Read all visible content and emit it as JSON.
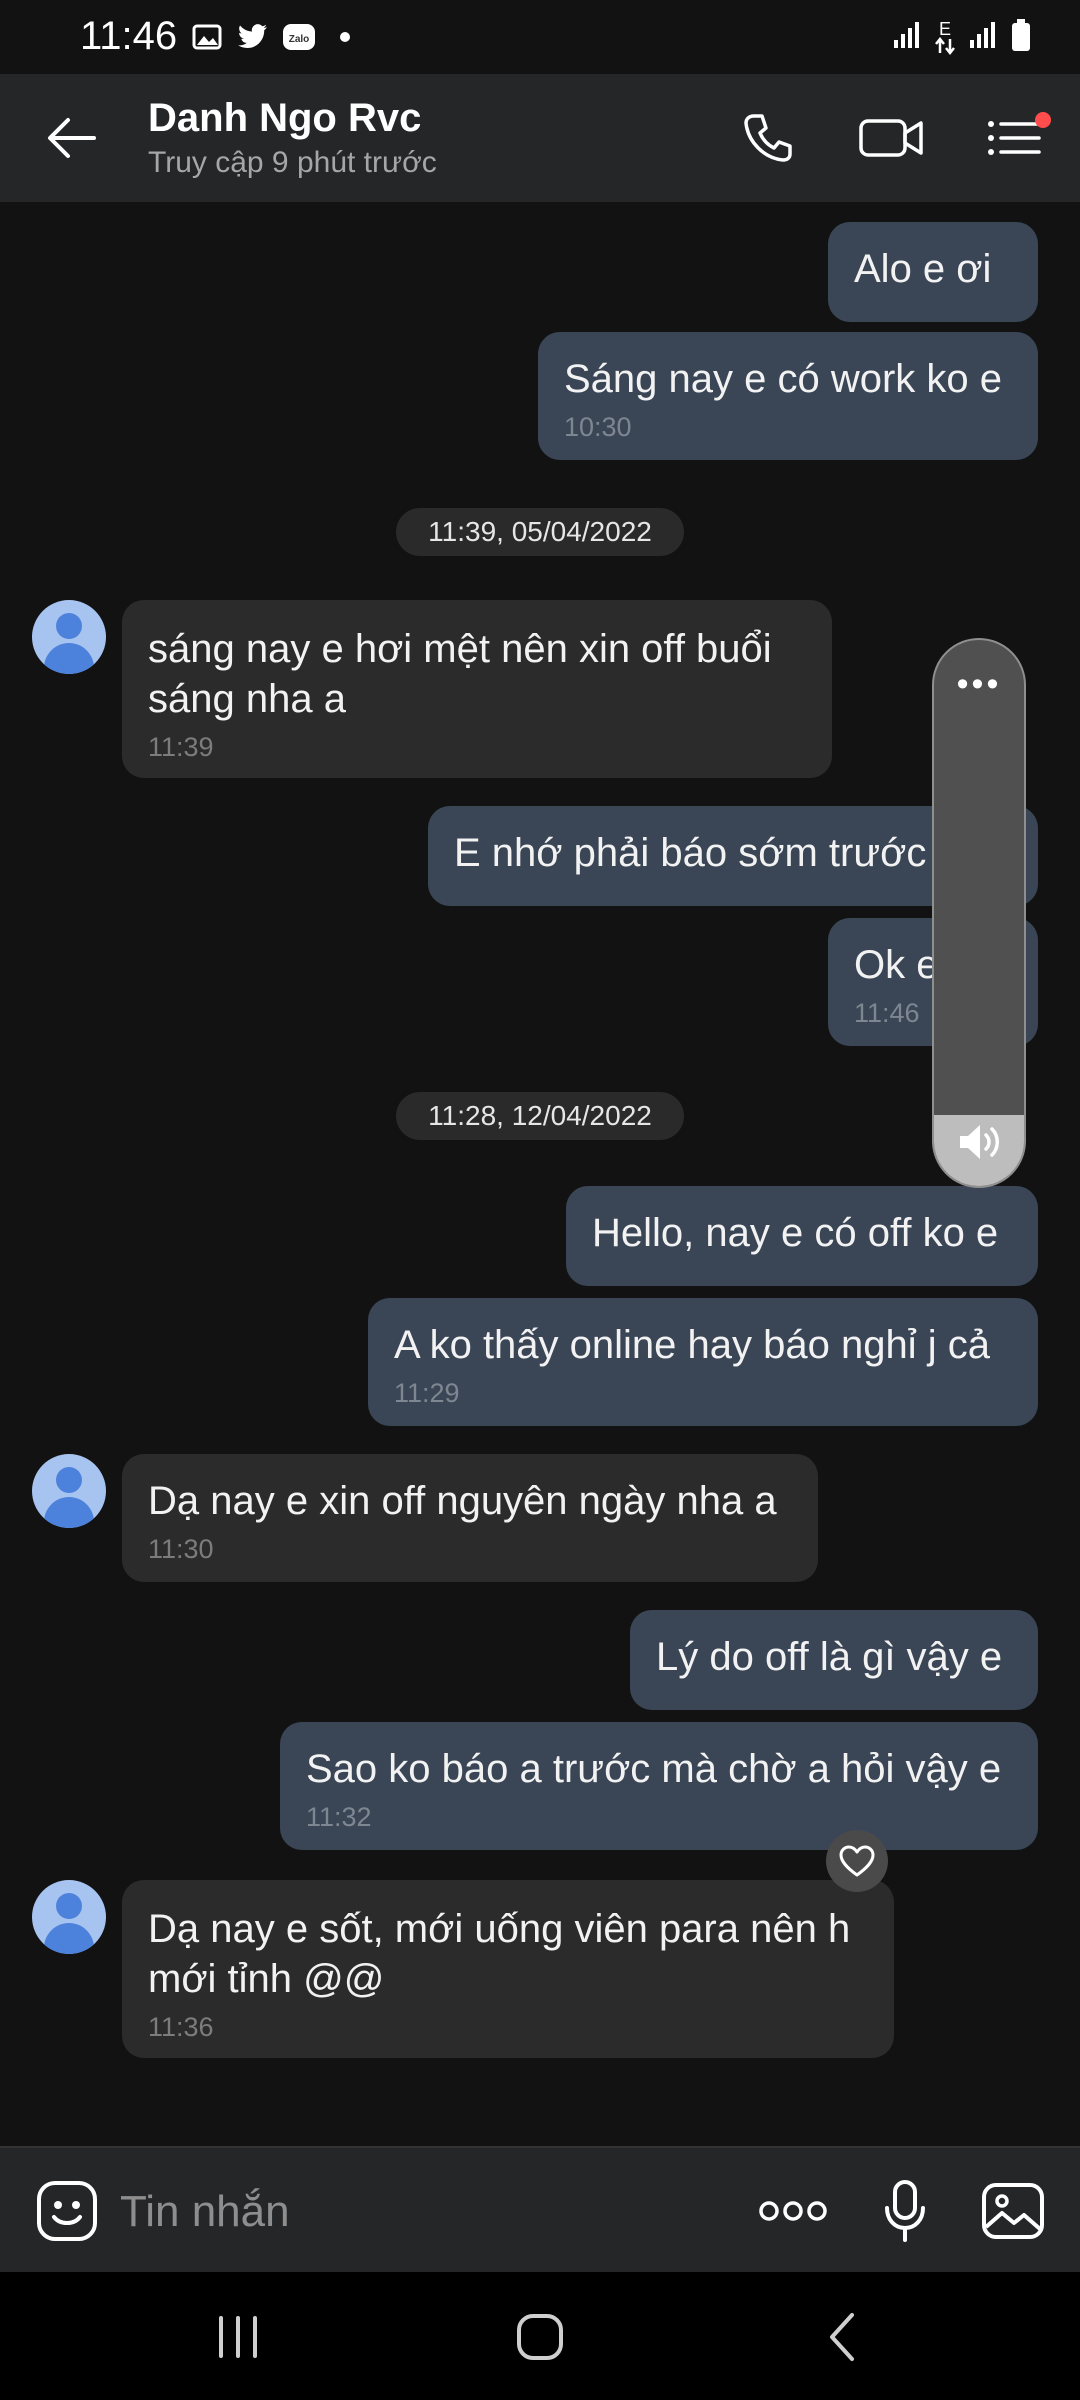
{
  "status_bar": {
    "time": "11:46",
    "network": "E",
    "left_icons": [
      "gallery-icon",
      "twitter-icon",
      "zalo-icon",
      "dot-icon"
    ],
    "right_icons": [
      "signal-icon",
      "data-arrows-icon",
      "signal-icon",
      "battery-icon"
    ]
  },
  "header": {
    "name": "Danh Ngo Rvc",
    "last_seen": "Truy cập 9 phút trước",
    "icons": [
      "back-arrow-icon",
      "phone-icon",
      "video-call-icon",
      "menu-list-icon"
    ],
    "menu_badge_color": "#ff4d4d"
  },
  "chat": {
    "messages": [
      {
        "side": "out",
        "text": "Alo e ơi",
        "time": ""
      },
      {
        "side": "out",
        "text": "Sáng nay e có work ko e",
        "time": "10:30"
      },
      {
        "type": "date",
        "text": "11:39, 05/04/2022"
      },
      {
        "side": "in",
        "text": "sáng nay e hơi mệt nên xin off buổi",
        "text2": "sáng nha a",
        "time": "11:39"
      },
      {
        "side": "out",
        "text": "E nhớ phải báo sớm trước nhé",
        "time": ""
      },
      {
        "side": "out",
        "text": "Ok e",
        "time": "11:46"
      },
      {
        "type": "date",
        "text": "11:28, 12/04/2022"
      },
      {
        "side": "out",
        "text": "Hello, nay e có off ko e",
        "time": ""
      },
      {
        "side": "out",
        "text": "A ko thấy online hay báo nghỉ j cả",
        "time": "11:29"
      },
      {
        "side": "in",
        "text": "Dạ nay e xin off nguyên ngày nha a",
        "time": "11:30"
      },
      {
        "side": "out",
        "text": "Lý do off là gì vậy e",
        "time": ""
      },
      {
        "side": "out",
        "text": "Sao ko báo a trước mà chờ a hỏi vậy e",
        "time": "11:32"
      },
      {
        "side": "in",
        "text": "Dạ nay e sốt, mới uống viên para nên h",
        "text2": "mới tỉnh @@",
        "time": "11:36"
      }
    ]
  },
  "volume_overlay": {
    "level": 0.13,
    "icons": [
      "more-dots-icon",
      "speaker-icon"
    ]
  },
  "composer": {
    "placeholder": "Tin nhắn",
    "icons": [
      "sticker-icon",
      "more-options-icon",
      "microphone-icon",
      "image-icon"
    ]
  },
  "nav_bar": {
    "icons": [
      "recent-apps-icon",
      "home-icon",
      "back-nav-icon"
    ]
  },
  "colors": {
    "background": "#121212",
    "header": "#252627",
    "outgoing_bubble": "#3a4656",
    "incoming_bubble": "#2b2b2b"
  }
}
